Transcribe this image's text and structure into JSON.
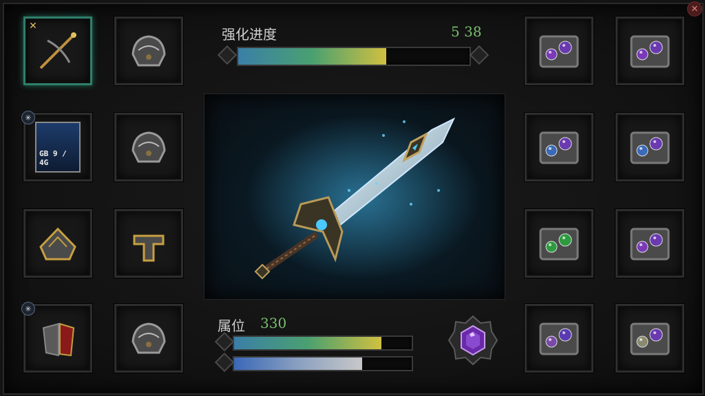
{
  "window": {
    "close_icon": "close-icon"
  },
  "enhance": {
    "label": "强化进度",
    "count_value": "5",
    "count_total": "38",
    "progress": 0.64
  },
  "attribute": {
    "label": "属位",
    "value": "330",
    "bar1_progress": 0.83,
    "bar2_progress": 0.72
  },
  "left_slots": [
    {
      "name": "crossbow",
      "badge": "✕",
      "selected": true
    },
    {
      "name": "pauldron-armor"
    },
    {
      "name": "weapon-card",
      "badge": "✳",
      "card_code": "GB 9 / 4G"
    },
    {
      "name": "pauldron-armor"
    },
    {
      "name": "gold-chest-armor"
    },
    {
      "name": "gold-leg-armor"
    },
    {
      "name": "red-cape-armor",
      "badge": "✳"
    },
    {
      "name": "pauldron-armor"
    }
  ],
  "right_slots": [
    {
      "gems": [
        "#7a3ab8",
        "#6a3ab0"
      ]
    },
    {
      "gems": [
        "#7a3ab8",
        "#6a3ab0"
      ]
    },
    {
      "gems": [
        "#3a6ab8",
        "#6a3ab0"
      ]
    },
    {
      "gems": [
        "#3a6ab8",
        "#6a3ab0"
      ]
    },
    {
      "gems": [
        "#2e9a40",
        "#2e9a40"
      ]
    },
    {
      "gems": [
        "#7a3ab8",
        "#6a3ab0"
      ]
    },
    {
      "gems": [
        "#7a4aa8",
        "#5a3ab0"
      ]
    },
    {
      "gems": [
        "#8a8a70",
        "#6a3ab0"
      ]
    }
  ],
  "colors": {
    "accent_green": "#7ac070",
    "selected_border": "#2f7f6a",
    "sword_glow": "#4ac8ff"
  }
}
